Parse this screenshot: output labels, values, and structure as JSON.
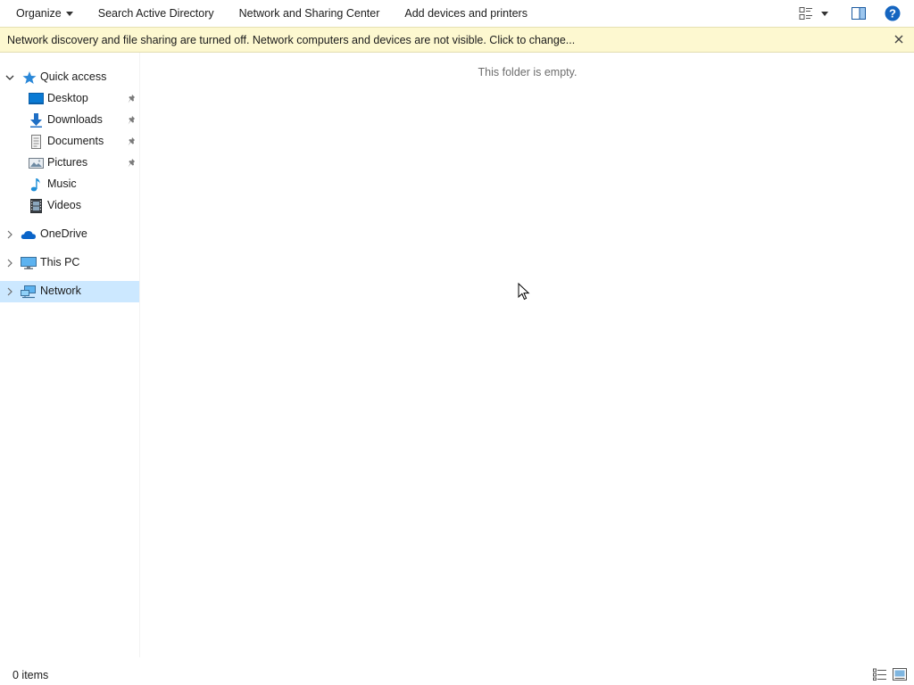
{
  "toolbar": {
    "organize_label": "Organize",
    "search_ad_label": "Search Active Directory",
    "network_sharing_label": "Network and Sharing Center",
    "add_devices_label": "Add devices and printers"
  },
  "infobar": {
    "message": "Network discovery and file sharing are turned off. Network computers and devices are not visible. Click to change..."
  },
  "nav": {
    "quick_access": "Quick access",
    "items": [
      {
        "label": "Desktop",
        "icon": "desktop-icon",
        "pinned": true
      },
      {
        "label": "Downloads",
        "icon": "downloads-icon",
        "pinned": true
      },
      {
        "label": "Documents",
        "icon": "documents-icon",
        "pinned": true
      },
      {
        "label": "Pictures",
        "icon": "pictures-icon",
        "pinned": true
      },
      {
        "label": "Music",
        "icon": "music-icon",
        "pinned": false
      },
      {
        "label": "Videos",
        "icon": "videos-icon",
        "pinned": false
      }
    ],
    "onedrive": "OneDrive",
    "this_pc": "This PC",
    "network": "Network",
    "selected": "Network"
  },
  "content": {
    "empty_message": "This folder is empty."
  },
  "status": {
    "item_count": "0 items"
  },
  "colors": {
    "selection": "#cce8ff",
    "infobar_bg": "#fdf8d0",
    "accent_blue": "#0078d7",
    "help_blue": "#1565c0"
  }
}
